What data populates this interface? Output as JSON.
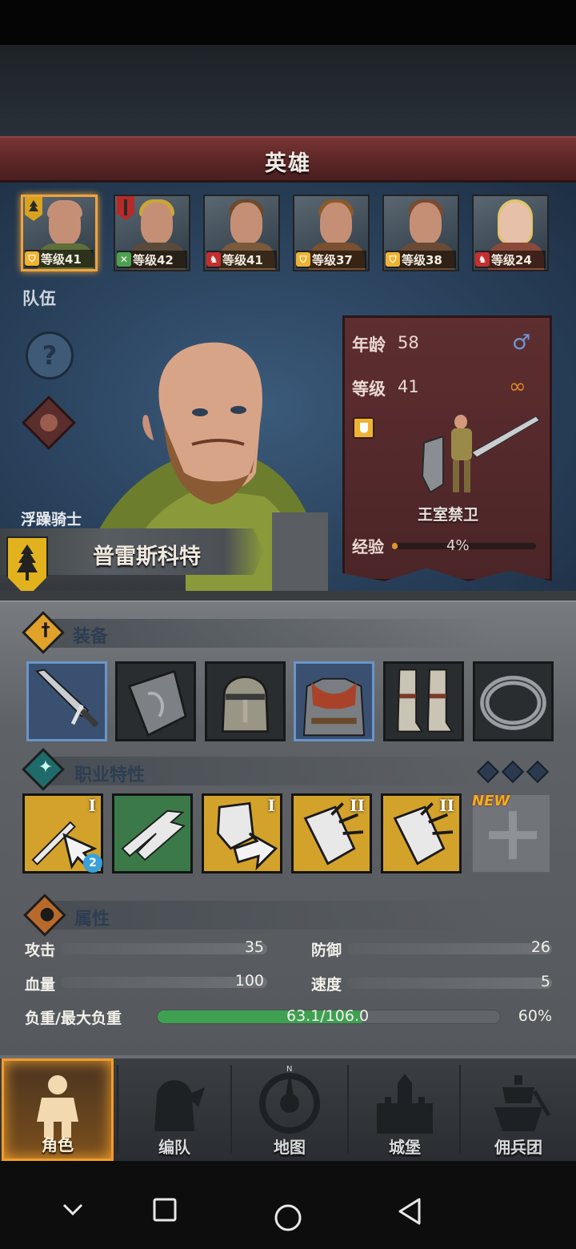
{
  "banner": {
    "title": "英雄"
  },
  "team_label": "队伍",
  "portraits": [
    {
      "level": "等级41",
      "class_icon": "shield-icon",
      "selected": true
    },
    {
      "level": "等级42",
      "class_icon": "crossed-swords-icon",
      "selected": false
    },
    {
      "level": "等级41",
      "class_icon": "horse-icon",
      "selected": false
    },
    {
      "level": "等级37",
      "class_icon": "shield-icon",
      "selected": false
    },
    {
      "level": "等级38",
      "class_icon": "shield-icon",
      "selected": false
    },
    {
      "level": "等级24",
      "class_icon": "horse-icon",
      "selected": false
    }
  ],
  "hero": {
    "trait_title": "浮躁骑士",
    "name": "普雷斯科特",
    "age_label": "年龄",
    "age": "58",
    "level_label": "等级",
    "level": "41",
    "unit_class": "王室禁卫",
    "exp_label": "经验",
    "exp_percent": "4%",
    "exp_fraction": 0.04
  },
  "sections": {
    "equipment": "装备",
    "traits": "职业特性",
    "attributes": "属性"
  },
  "equipment": [
    {
      "icon": "sword-icon",
      "highlighted": true
    },
    {
      "icon": "shield-icon",
      "highlighted": false
    },
    {
      "icon": "helmet-icon",
      "highlighted": false
    },
    {
      "icon": "chainmail-armor-icon",
      "highlighted": true
    },
    {
      "icon": "greaves-icon",
      "highlighted": false
    },
    {
      "icon": "ring-icon",
      "highlighted": false
    }
  ],
  "traits": [
    {
      "icon": "sword-cursor-icon",
      "rank": "I",
      "color": "gold",
      "gem": "2"
    },
    {
      "icon": "eagle-dash-icon",
      "rank": "",
      "color": "green"
    },
    {
      "icon": "shield-arrow-icon",
      "rank": "I",
      "color": "gold"
    },
    {
      "icon": "shield-break-icon",
      "rank": "II",
      "color": "gold"
    },
    {
      "icon": "shield-break-icon",
      "rank": "II",
      "color": "gold"
    }
  ],
  "new_slot": {
    "tag": "NEW",
    "icon": "plus-cross-icon"
  },
  "attributes": {
    "attack_label": "攻击",
    "attack": "35",
    "defense_label": "防御",
    "defense": "26",
    "hp_label": "血量",
    "hp": "100",
    "speed_label": "速度",
    "speed": "5",
    "load_label": "负重/最大负重",
    "load": "63.1/106.0",
    "load_percent": "60%",
    "load_fraction": 0.595
  },
  "tabs": [
    {
      "label": "角色",
      "icon": "knight-icon",
      "active": true
    },
    {
      "label": "编队",
      "icon": "helmet-icon",
      "active": false
    },
    {
      "label": "地图",
      "icon": "compass-icon",
      "active": false
    },
    {
      "label": "城堡",
      "icon": "castle-icon",
      "active": false
    },
    {
      "label": "佣兵团",
      "icon": "mercenary-icon",
      "active": false
    }
  ],
  "colors": {
    "accent": "#f39c2b",
    "banner": "#6a2c2d",
    "panel": "#55595d"
  }
}
